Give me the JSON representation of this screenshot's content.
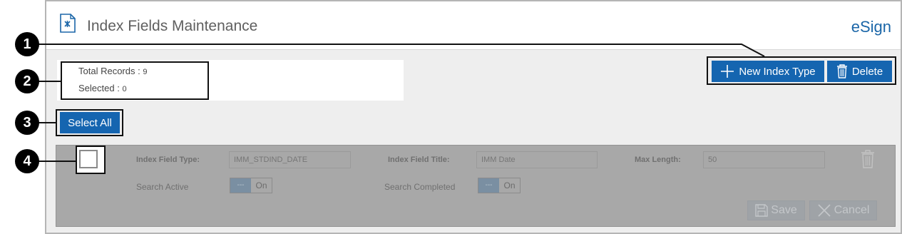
{
  "header": {
    "title": "Index Fields Maintenance",
    "brand": "eSign",
    "icon": "document-icon"
  },
  "stats": {
    "total_label": "Total Records : ",
    "total_value": "9",
    "selected_label": "Selected : ",
    "selected_value": "0"
  },
  "toolbar": {
    "new_label": "New Index Type",
    "delete_label": "Delete",
    "select_all_label": "Select All"
  },
  "record": {
    "type_label": "Index Field Type:",
    "type_value": "IMM_STDIND_DATE",
    "title_label": "Index Field Title:",
    "title_value": "IMM Date",
    "max_label": "Max Length:",
    "max_value": "50",
    "search_active_label": "Search Active",
    "search_completed_label": "Search Completed",
    "toggle_off": "---",
    "toggle_on": "On",
    "save_label": "Save",
    "cancel_label": "Cancel"
  },
  "callouts": [
    "1",
    "2",
    "3",
    "4"
  ],
  "colors": {
    "accent": "#1565b0",
    "brand": "#1b66a8",
    "record_bg": "#a8a8a8"
  }
}
